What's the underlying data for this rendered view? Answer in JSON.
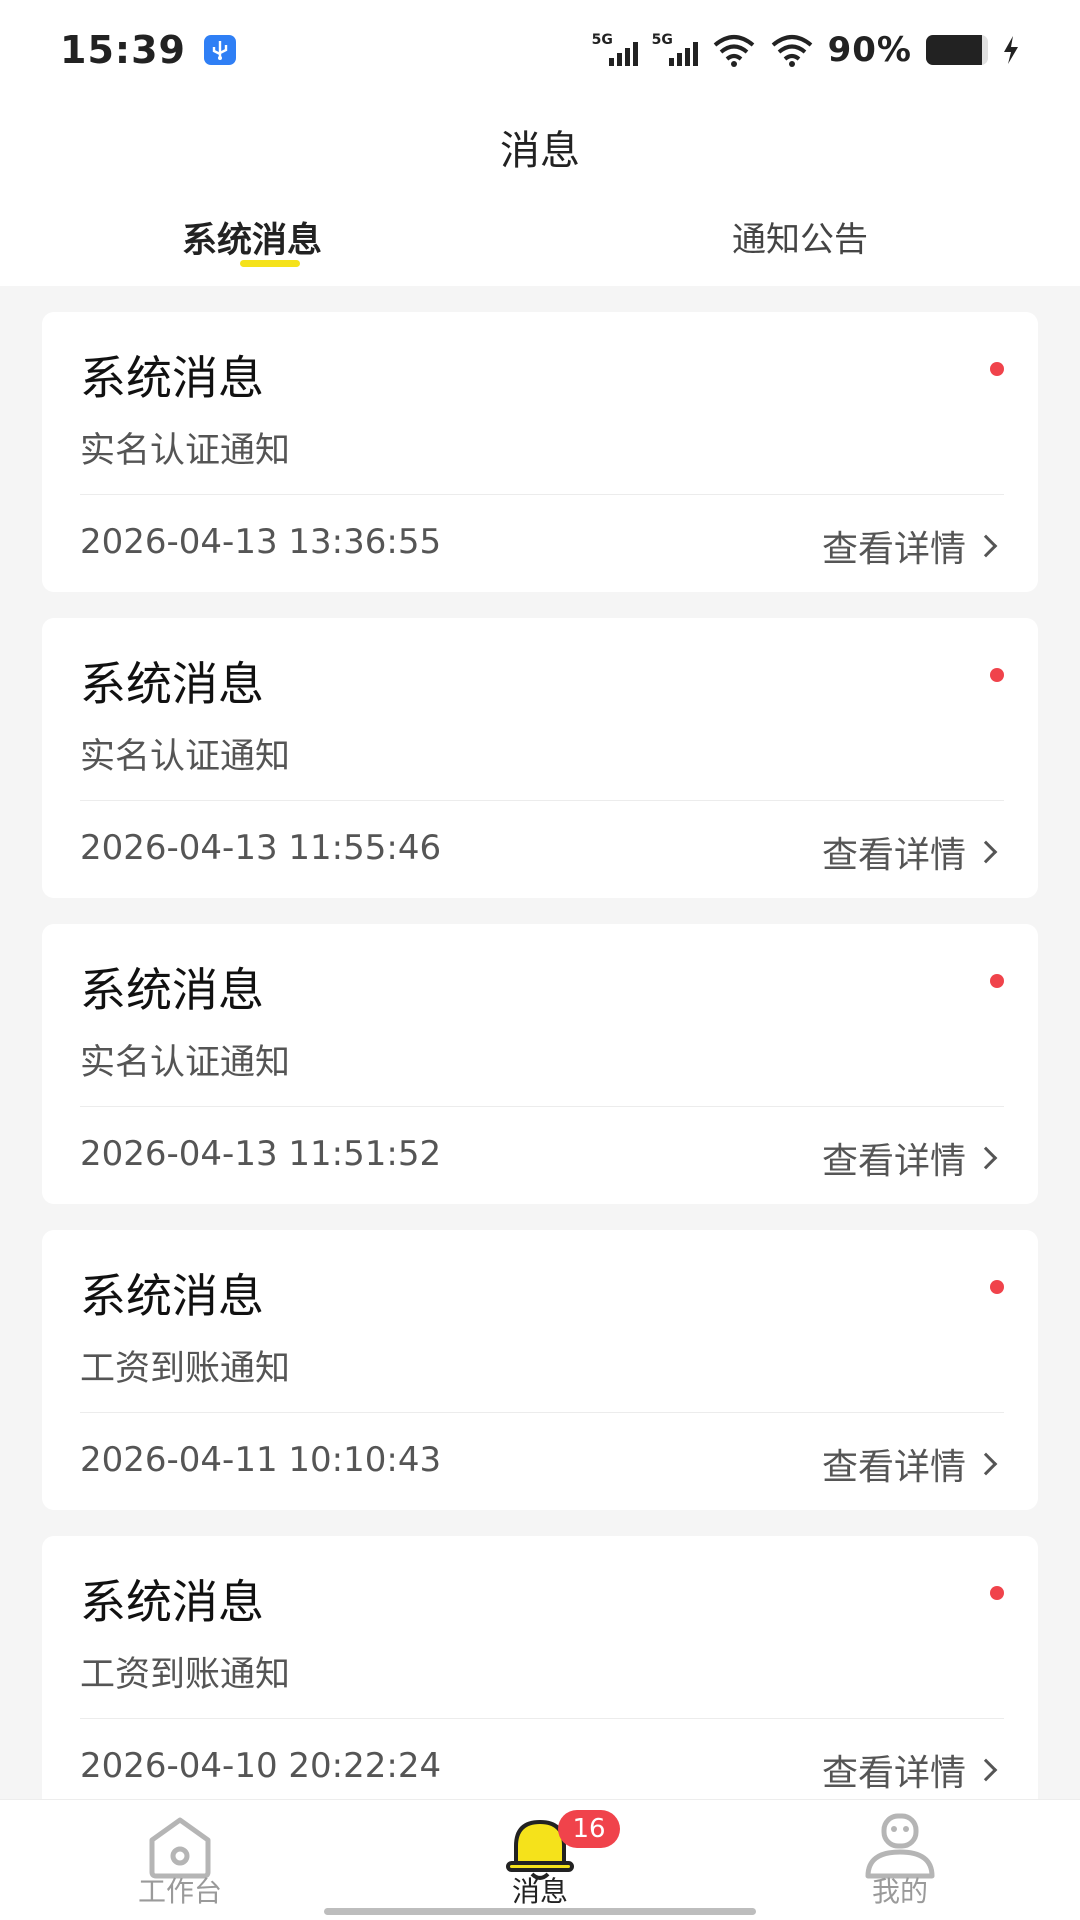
{
  "status_bar": {
    "time": "15:39",
    "signal_1_label": "5G",
    "signal_2_label": "5G",
    "battery_percent": "90%",
    "battery_level": 0.9,
    "icons": [
      "usb-icon",
      "signal-icon",
      "wifi-icon",
      "battery-icon",
      "charging-icon"
    ]
  },
  "header": {
    "title": "消息",
    "tabs": [
      {
        "label": "系统消息",
        "active": true
      },
      {
        "label": "通知公告",
        "active": false
      }
    ]
  },
  "colors": {
    "accent": "#f5e21b",
    "unread_dot": "#f0434b",
    "badge": "#f0434b",
    "usb_icon": "#2f7ff5"
  },
  "messages": [
    {
      "title": "系统消息",
      "subtitle": "实名认证通知",
      "time": "2026-04-13 13:36:55",
      "action": "查看详情",
      "unread": true
    },
    {
      "title": "系统消息",
      "subtitle": "实名认证通知",
      "time": "2026-04-13 11:55:46",
      "action": "查看详情",
      "unread": true
    },
    {
      "title": "系统消息",
      "subtitle": "实名认证通知",
      "time": "2026-04-13 11:51:52",
      "action": "查看详情",
      "unread": true
    },
    {
      "title": "系统消息",
      "subtitle": "工资到账通知",
      "time": "2026-04-11 10:10:43",
      "action": "查看详情",
      "unread": true
    },
    {
      "title": "系统消息",
      "subtitle": "工资到账通知",
      "time": "2026-04-10 20:22:24",
      "action": "查看详情",
      "unread": true
    }
  ],
  "bottom_nav": {
    "items": [
      {
        "label": "工作台",
        "icon": "home-icon",
        "active": false
      },
      {
        "label": "消息",
        "icon": "bell-icon",
        "active": true,
        "badge": "16"
      },
      {
        "label": "我的",
        "icon": "profile-icon",
        "active": false
      }
    ]
  }
}
